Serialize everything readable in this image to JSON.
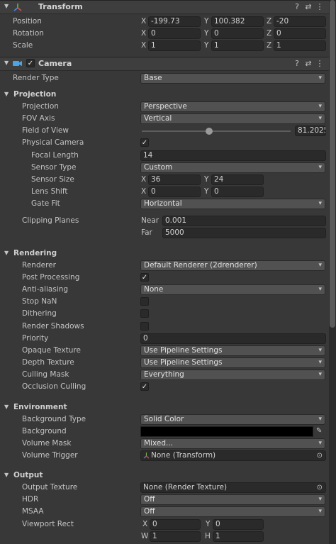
{
  "transform": {
    "title": "Transform",
    "position_label": "Position",
    "rotation_label": "Rotation",
    "scale_label": "Scale",
    "axis_x": "X",
    "axis_y": "Y",
    "axis_z": "Z",
    "position": {
      "x": "-199.73",
      "y": "100.382",
      "z": "-20"
    },
    "rotation": {
      "x": "0",
      "y": "0",
      "z": "0"
    },
    "scale": {
      "x": "1",
      "y": "1",
      "z": "1"
    }
  },
  "camera": {
    "title": "Camera",
    "render_type_label": "Render Type",
    "render_type": "Base",
    "projection_section": "Projection",
    "projection_label": "Projection",
    "projection": "Perspective",
    "fov_axis_label": "FOV Axis",
    "fov_axis": "Vertical",
    "fov_label": "Field of View",
    "fov": "81.2025",
    "fov_fraction": 0.45,
    "physical_camera_label": "Physical Camera",
    "physical_camera_checked": true,
    "focal_length_label": "Focal Length",
    "focal_length": "14",
    "sensor_type_label": "Sensor Type",
    "sensor_type": "Custom",
    "sensor_size_label": "Sensor Size",
    "sensor_x": "36",
    "sensor_y": "24",
    "lens_shift_label": "Lens Shift",
    "lens_shift_x": "0",
    "lens_shift_y": "0",
    "gate_fit_label": "Gate Fit",
    "gate_fit": "Horizontal",
    "clipping_label": "Clipping Planes",
    "near_label": "Near",
    "near": "0.001",
    "far_label": "Far",
    "far": "5000",
    "rendering_section": "Rendering",
    "renderer_label": "Renderer",
    "renderer": "Default Renderer (2drenderer)",
    "post_processing_label": "Post Processing",
    "anti_aliasing_label": "Anti-aliasing",
    "anti_aliasing": "None",
    "stop_nan_label": "Stop NaN",
    "dithering_label": "Dithering",
    "render_shadows_label": "Render Shadows",
    "priority_label": "Priority",
    "priority": "0",
    "opaque_texture_label": "Opaque Texture",
    "opaque_texture": "Use Pipeline Settings",
    "depth_texture_label": "Depth Texture",
    "depth_texture": "Use Pipeline Settings",
    "culling_mask_label": "Culling Mask",
    "culling_mask": "Everything",
    "occlusion_label": "Occlusion Culling",
    "environment_section": "Environment",
    "bg_type_label": "Background Type",
    "bg_type": "Solid Color",
    "background_label": "Background",
    "background_color": "#000000",
    "volume_mask_label": "Volume Mask",
    "volume_mask": "Mixed...",
    "volume_trigger_label": "Volume Trigger",
    "volume_trigger": "None (Transform)",
    "output_section": "Output",
    "output_texture_label": "Output Texture",
    "output_texture": "None (Render Texture)",
    "hdr_label": "HDR",
    "hdr": "Off",
    "msaa_label": "MSAA",
    "msaa": "Off",
    "viewport_label": "Viewport Rect",
    "vp_x_label": "X",
    "vp_y_label": "Y",
    "vp_w_label": "W",
    "vp_h_label": "H",
    "vp_x": "0",
    "vp_y": "0",
    "vp_w": "1",
    "vp_h": "1",
    "check_mark": "✓"
  },
  "icons": {
    "help": "?",
    "settings": "⇄",
    "menu": "⋮",
    "fold_open": "▼",
    "dropdown_arrow": "▾",
    "picker": "⊙",
    "eyedropper": "✎"
  }
}
